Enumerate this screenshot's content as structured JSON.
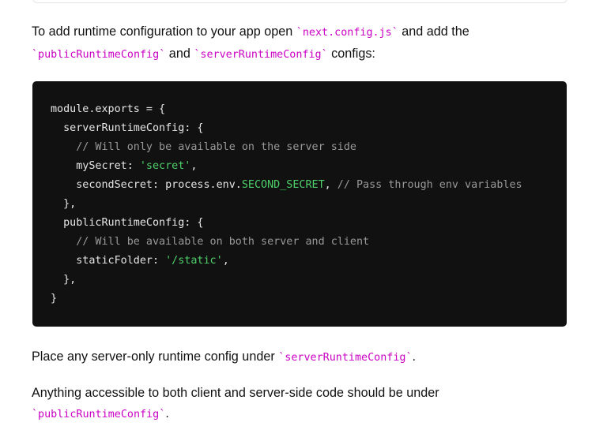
{
  "intro": {
    "text_before": "To add runtime configuration to your app open ",
    "file_code": "`next.config.js`",
    "text_after_file": " and add the",
    "public_code": "`publicRuntimeConfig`",
    "and_word": " and ",
    "server_code": "`serverRuntimeConfig`",
    "text_end": " configs:"
  },
  "code": {
    "l1": "module.exports = {",
    "l2": "  serverRuntimeConfig: {",
    "l3_indent": "    ",
    "l3_comment": "// Will only be available on the server side",
    "l4_key": "    mySecret: ",
    "l4_value": "'secret'",
    "l4_end": ",",
    "l5_key": "    secondSecret: process.env.",
    "l5_env": "SECOND_SECRET",
    "l5_sep": ", ",
    "l5_comment": "// Pass through env variables",
    "l6": "  },",
    "l7": "  publicRuntimeConfig: {",
    "l8_indent": "    ",
    "l8_comment": "// Will be available on both server and client",
    "l9_key": "    staticFolder: ",
    "l9_value": "'/static'",
    "l9_end": ",",
    "l10": "  },",
    "l11": "}"
  },
  "para_server": {
    "text": "Place any server-only runtime config under ",
    "code": "`serverRuntimeConfig`",
    "end": "."
  },
  "para_public": {
    "text": "Anything accessible to both client and server-side code should be under",
    "code": "`publicRuntimeConfig`",
    "end": "."
  },
  "colors": {
    "inline_code": "#ca00c4",
    "code_bg": "#111111",
    "string": "#4ed06a",
    "comment": "#999999"
  }
}
